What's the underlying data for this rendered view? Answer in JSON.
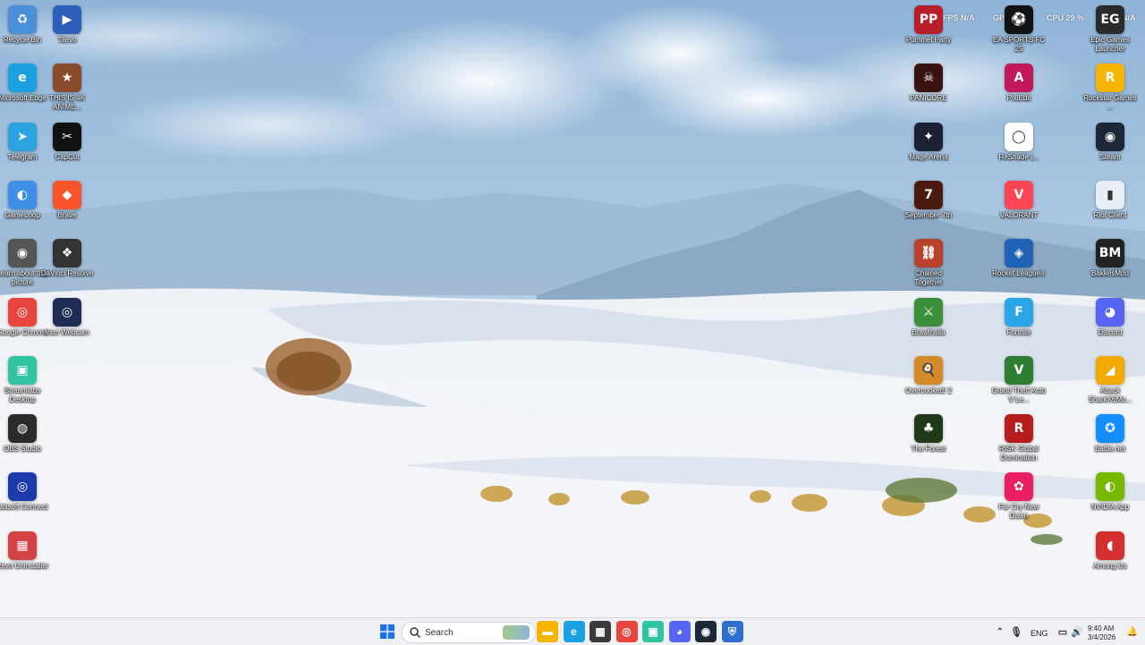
{
  "overlay": {
    "fps": "FPS  N/A",
    "gpu": "GPU  %",
    "cpu": "CPU  29 %",
    "ram": "N/A"
  },
  "left_column_1": [
    {
      "label": "Recycle Bin",
      "icon": "recycle-bin-icon",
      "color": "#4a90d9",
      "glyph": "♻"
    },
    {
      "label": "Microsoft Edge",
      "icon": "edge-icon",
      "color": "#1ba1e2",
      "glyph": "e"
    },
    {
      "label": "Telegram",
      "icon": "telegram-icon",
      "color": "#2aa3df",
      "glyph": "➤"
    },
    {
      "label": "GameLoop",
      "icon": "gameloop-icon",
      "color": "#3f8fe8",
      "glyph": "◐"
    },
    {
      "label": "Learn about this picture",
      "icon": "camera-icon",
      "color": "#555555",
      "glyph": "◉"
    },
    {
      "label": "Google Chrome",
      "icon": "chrome-icon",
      "color": "#e8453c",
      "glyph": "◎"
    },
    {
      "label": "Streamlabs Desktop",
      "icon": "streamlabs-icon",
      "color": "#31c3a2",
      "glyph": "▣"
    },
    {
      "label": "OBS Studio",
      "icon": "obs-icon",
      "color": "#2b2b2b",
      "glyph": "◍"
    },
    {
      "label": "Ubisoft Connect",
      "icon": "ubisoft-icon",
      "color": "#1c3aa9",
      "glyph": "◎"
    },
    {
      "label": "Revo Uninstaller",
      "icon": "revo-uninstaller-icon",
      "color": "#d44343",
      "glyph": "▦"
    }
  ],
  "left_column_2": [
    {
      "label": "Tilevo",
      "icon": "tilevo-icon",
      "color": "#2d5fb8",
      "glyph": "▶"
    },
    {
      "label": "THIS IS 4K ANIME...",
      "icon": "anime-shortcut-icon",
      "color": "#8a4b2b",
      "glyph": "★"
    },
    {
      "label": "CapCut",
      "icon": "capcut-icon",
      "color": "#111111",
      "glyph": "✂"
    },
    {
      "label": "Brave",
      "icon": "brave-icon",
      "color": "#fb542b",
      "glyph": "◆"
    },
    {
      "label": "DaVinci Resolve",
      "icon": "davinci-icon",
      "color": "#333333",
      "glyph": "❖"
    },
    {
      "label": "Iriun Webcam",
      "icon": "iriun-webcam-icon",
      "color": "#1d2c52",
      "glyph": "◎"
    }
  ],
  "right_column_1": [
    {
      "label": "Pummel Party",
      "icon": "pummel-party-icon",
      "color": "#b81d2a",
      "glyph": "PP"
    },
    {
      "label": "PANICORE",
      "icon": "panicore-icon",
      "color": "#3a1212",
      "glyph": "☠"
    },
    {
      "label": "Mage Arena",
      "icon": "mage-arena-icon",
      "color": "#1b2033",
      "glyph": "✦"
    },
    {
      "label": "September 7th",
      "icon": "september-7th-icon",
      "color": "#4a1a10",
      "glyph": "7"
    },
    {
      "label": "Chained Together",
      "icon": "chained-together-icon",
      "color": "#b9402b",
      "glyph": "⛓"
    },
    {
      "label": "Brawlhalla",
      "icon": "brawlhalla-icon",
      "color": "#3b8f3b",
      "glyph": "⚔"
    },
    {
      "label": "Overcooked! 2",
      "icon": "overcooked-icon",
      "color": "#d58a2a",
      "glyph": "🍳"
    },
    {
      "label": "The Forest",
      "icon": "the-forest-icon",
      "color": "#203a18",
      "glyph": "♣"
    }
  ],
  "right_column_2": [
    {
      "label": "EA SPORTS FC 25",
      "icon": "ea-fc-icon",
      "color": "#111111",
      "glyph": "⚽"
    },
    {
      "label": "PixiEdit",
      "icon": "pixiedit-icon",
      "color": "#c2185b",
      "glyph": "A"
    },
    {
      "label": "ReShade (...",
      "icon": "reshade-icon",
      "color": "#ffffff",
      "glyph": "◯"
    },
    {
      "label": "VALORANT",
      "icon": "valorant-icon",
      "color": "#fd4556",
      "glyph": "V"
    },
    {
      "label": "Rocket League®",
      "icon": "rocket-league-icon",
      "color": "#1f63b6",
      "glyph": "◈"
    },
    {
      "label": "Fortnite",
      "icon": "fortnite-icon",
      "color": "#2aa6e8",
      "glyph": "F"
    },
    {
      "label": "Grand Theft Auto V Le...",
      "icon": "gta-v-icon",
      "color": "#2e7d32",
      "glyph": "V"
    },
    {
      "label": "RISK Global Domination",
      "icon": "risk-icon",
      "color": "#b71c1c",
      "glyph": "R"
    },
    {
      "label": "Far Cry New Dawn",
      "icon": "far-cry-icon",
      "color": "#e91e63",
      "glyph": "✿"
    }
  ],
  "right_column_3": [
    {
      "label": "Epic Games Launcher",
      "icon": "epic-games-icon",
      "color": "#2a2a2a",
      "glyph": "EG"
    },
    {
      "label": "Rockstar Games ...",
      "icon": "rockstar-icon",
      "color": "#f7b500",
      "glyph": "R"
    },
    {
      "label": "Steam",
      "icon": "steam-icon",
      "color": "#1b2838",
      "glyph": "◉"
    },
    {
      "label": "Riot Client",
      "icon": "riot-client-icon",
      "color": "#e7eef5",
      "glyph": "▮"
    },
    {
      "label": "BakkesMod",
      "icon": "bakkesmod-icon",
      "color": "#222222",
      "glyph": "BM"
    },
    {
      "label": "Discord",
      "icon": "discord-icon",
      "color": "#5865f2",
      "glyph": "◕"
    },
    {
      "label": "Attack SharkX6Mo...",
      "icon": "attack-shark-icon",
      "color": "#f2a900",
      "glyph": "◢"
    },
    {
      "label": "Battle.net",
      "icon": "battlenet-icon",
      "color": "#148eff",
      "glyph": "✪"
    },
    {
      "label": "NVIDIA App",
      "icon": "nvidia-icon",
      "color": "#76b900",
      "glyph": "◐"
    },
    {
      "label": "Among Us",
      "icon": "among-us-icon",
      "color": "#d32f2f",
      "glyph": "◖"
    }
  ],
  "taskbar": {
    "search_label": "Search",
    "language": "ENG",
    "time": "9:40 AM",
    "date": "3/4/2026",
    "pinned": [
      {
        "name": "file-explorer-icon",
        "color": "#f4b400",
        "glyph": "▬"
      },
      {
        "name": "edge-icon",
        "color": "#1ba1e2",
        "glyph": "e"
      },
      {
        "name": "microsoft-store-icon",
        "color": "#3a3a3a",
        "glyph": "▦"
      },
      {
        "name": "chrome-icon",
        "color": "#e8453c",
        "glyph": "◎"
      },
      {
        "name": "streamlabs-icon",
        "color": "#31c3a2",
        "glyph": "▣"
      },
      {
        "name": "discord-icon",
        "color": "#5865f2",
        "glyph": "◕"
      },
      {
        "name": "steam-icon",
        "color": "#1b2838",
        "glyph": "◉"
      },
      {
        "name": "vpn-shield-icon",
        "color": "#2f6fd0",
        "glyph": "⛨"
      }
    ]
  }
}
